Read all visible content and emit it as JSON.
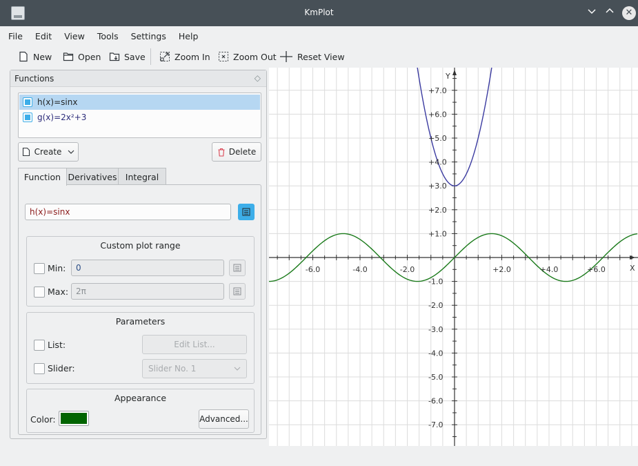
{
  "window": {
    "title": "KmPlot"
  },
  "menu": [
    "File",
    "Edit",
    "View",
    "Tools",
    "Settings",
    "Help"
  ],
  "toolbar": {
    "new": "New",
    "open": "Open",
    "save": "Save",
    "zoom_in": "Zoom In",
    "zoom_out": "Zoom Out",
    "reset_view": "Reset View"
  },
  "functions_panel": {
    "title": "Functions",
    "items": [
      {
        "label": "h(x)=sinx",
        "checked": true,
        "selected": true
      },
      {
        "label": "g(x)=2x²+3",
        "checked": true,
        "selected": false
      }
    ],
    "create_label": "Create",
    "delete_label": "Delete",
    "tabs": [
      "Function",
      "Derivatives",
      "Integral"
    ],
    "active_tab": "Function",
    "equation_value": "h(x)=sinx",
    "plot_range": {
      "title": "Custom plot range",
      "min_label": "Min:",
      "min_value": "0",
      "max_label": "Max:",
      "max_value": "2π"
    },
    "parameters": {
      "title": "Parameters",
      "list_label": "List:",
      "edit_list_label": "Edit List...",
      "slider_label": "Slider:",
      "slider_value": "Slider No. 1"
    },
    "appearance": {
      "title": "Appearance",
      "color_label": "Color:",
      "color_value": "#006400",
      "advanced_label": "Advanced..."
    }
  },
  "plot": {
    "x_axis_label": "X",
    "y_axis_label": "Y",
    "x_ticks": [
      "-6.0",
      "-4.0",
      "-2.0",
      "+2.0",
      "+4.0",
      "+6.0"
    ],
    "y_ticks": [
      "+7.0",
      "+6.0",
      "+5.0",
      "+4.0",
      "+3.0",
      "+2.0",
      "+1.0",
      "-1.0",
      "-2.0",
      "-3.0",
      "-4.0",
      "-5.0",
      "-6.0",
      "-7.0"
    ],
    "x_range": [
      -7.8,
      7.7
    ],
    "y_range": [
      -7.9,
      7.8
    ],
    "functions": [
      {
        "name": "h(x)=sinx",
        "color": "#1a7a1a"
      },
      {
        "name": "g(x)=2x²+3",
        "color": "#3a3aa0"
      }
    ],
    "grid": true
  }
}
